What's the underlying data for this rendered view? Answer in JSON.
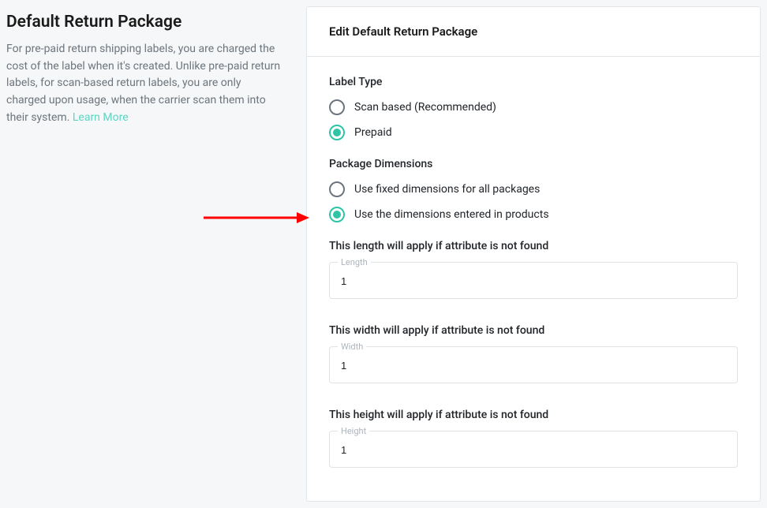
{
  "left": {
    "title": "Default Return Package",
    "description": "For pre-paid return shipping labels, you are charged the cost of the label when it's created. Unlike pre-paid return labels, for scan-based return labels, you are only charged upon usage, when the carrier scan them into their system. ",
    "learn_more": "Learn More"
  },
  "panel": {
    "title": "Edit Default Return Package"
  },
  "label_type": {
    "heading": "Label Type",
    "options": {
      "scan": "Scan based (Recommended)",
      "prepaid": "Prepaid"
    }
  },
  "dimensions": {
    "heading": "Package Dimensions",
    "options": {
      "fixed": "Use fixed dimensions for all packages",
      "product": "Use the dimensions entered in products"
    }
  },
  "fields": {
    "length": {
      "desc": "This length will apply if attribute is not found",
      "label": "Length",
      "value": "1"
    },
    "width": {
      "desc": "This width will apply if attribute is not found",
      "label": "Width",
      "value": "1"
    },
    "height": {
      "desc": "This height will apply if attribute is not found",
      "label": "Height",
      "value": "1"
    }
  }
}
